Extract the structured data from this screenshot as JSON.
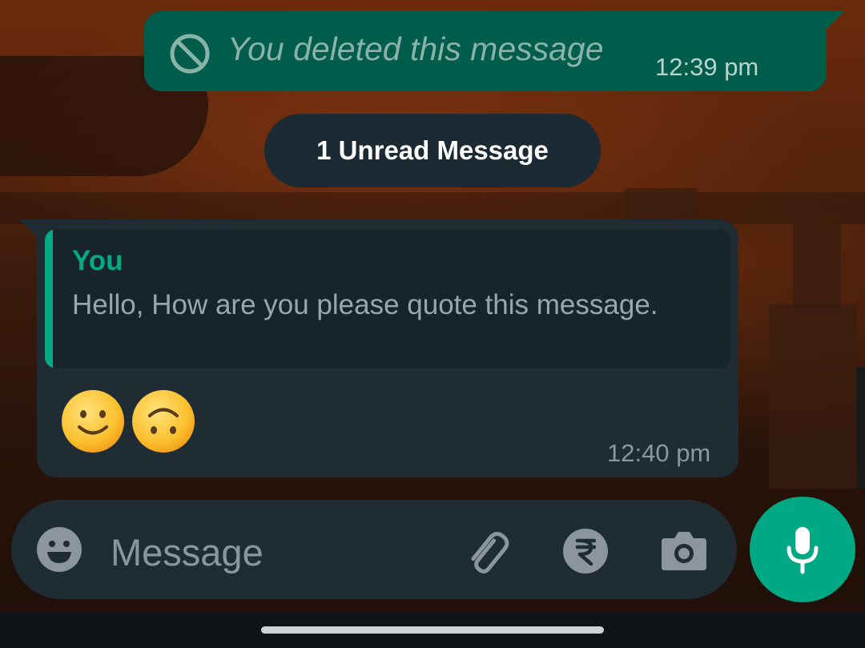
{
  "chat": {
    "deleted_message": {
      "text": "You deleted this message",
      "time": "12:39 pm",
      "icon": "ban-icon"
    },
    "unread_banner": "1 Unread Message",
    "received_message": {
      "quote_author": "You",
      "quote_text": "Hello, How are you please quote this message.",
      "emojis": [
        "slightly-smiling-face",
        "upside-down-face"
      ],
      "time": "12:40 pm"
    }
  },
  "composer": {
    "placeholder": "Message",
    "icons": [
      "emoji-icon",
      "attach-icon",
      "rupee-payment-icon",
      "camera-icon",
      "mic-icon"
    ]
  },
  "colors": {
    "sent_bubble": "#005c4b",
    "received_bubble": "#1f2c34",
    "accent": "#00a884",
    "quote_accent": "#06a884"
  }
}
